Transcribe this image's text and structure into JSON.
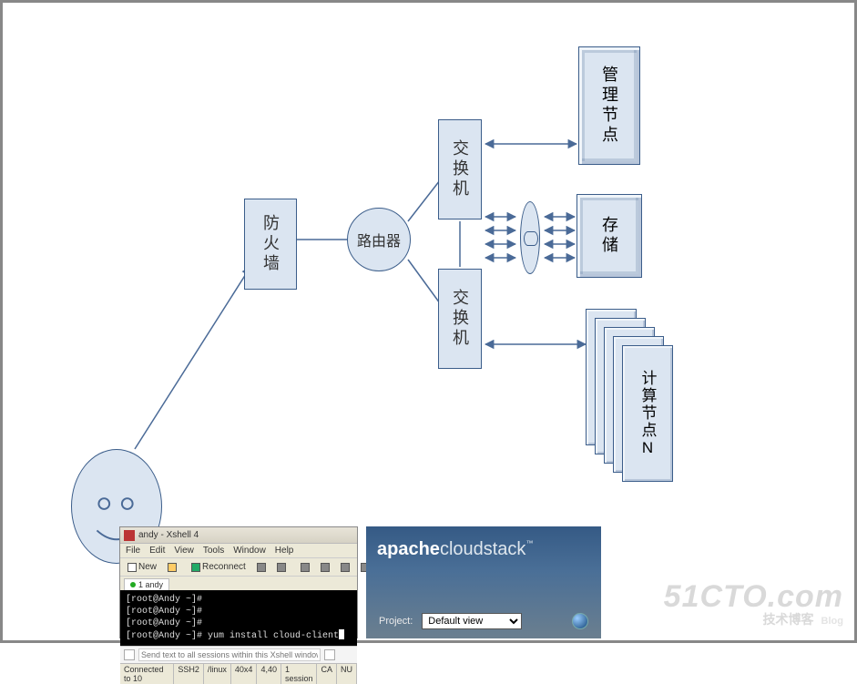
{
  "diagram": {
    "firewall_label": "防火墙",
    "router_label": "路由器",
    "switch_label_top": "交换机",
    "switch_label_bottom": "交换机",
    "mgmt_node_label": "管理节点",
    "storage_label": "存储",
    "compute_label": "计算节点N"
  },
  "xshell": {
    "title": "andy - Xshell 4",
    "menu": [
      "File",
      "Edit",
      "View",
      "Tools",
      "Window",
      "Help"
    ],
    "toolbar_new": "New",
    "toolbar_reconnect": "Reconnect",
    "tab": "1 andy",
    "lines": [
      "[root@Andy ~]#",
      "[root@Andy ~]#",
      "[root@Andy ~]#",
      "[root@Andy ~]# yum install cloud-client"
    ],
    "hint": "Send text to all sessions within this Xshell window.",
    "status": [
      "Connected to 10",
      "SSH2",
      "/linux",
      "40x4",
      "4,40",
      "1 session"
    ],
    "status_right": [
      "CA",
      "NU"
    ]
  },
  "acs": {
    "brand_bold": "apache",
    "brand_rest": "cloudstack",
    "project_label": "Project:",
    "project_value": "Default view"
  },
  "watermark": {
    "big": "51CTO.com",
    "sub_cn": "技术博客",
    "sub_en": "Blog"
  }
}
